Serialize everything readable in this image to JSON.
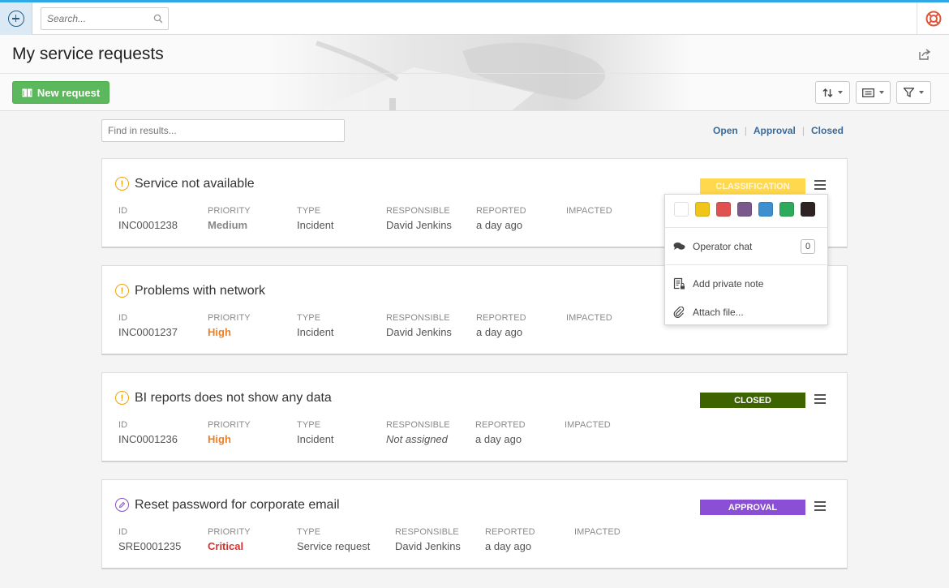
{
  "topbar": {
    "search_placeholder": "Search..."
  },
  "header": {
    "title": "My service requests",
    "new_request_label": "New request"
  },
  "filter": {
    "find_placeholder": "Find in results...",
    "tabs": [
      {
        "label": "Open"
      },
      {
        "label": "Approval"
      },
      {
        "label": "Closed"
      }
    ]
  },
  "field_labels": {
    "id": "ID",
    "priority": "PRIORITY",
    "type": "TYPE",
    "responsible": "RESPONSIBLE",
    "reported": "REPORTED",
    "impacted": "IMPACTED"
  },
  "requests": [
    {
      "title": "Service not available",
      "id": "INC0001238",
      "priority": "Medium",
      "type": "Incident",
      "responsible": "David Jenkins",
      "reported": "a day ago",
      "impacted": "",
      "status": "CLASSIFICATION",
      "status_color": "#ffd84d",
      "icon": "warning-icon"
    },
    {
      "title": "Problems with network",
      "id": "INC0001237",
      "priority": "High",
      "type": "Incident",
      "responsible": "David Jenkins",
      "reported": "a day ago",
      "impacted": "",
      "status": "",
      "icon": "warning-icon"
    },
    {
      "title": "BI reports does not show any data",
      "id": "INC0001236",
      "priority": "High",
      "type": "Incident",
      "responsible": "Not assigned",
      "reported": "a day ago",
      "impacted": "",
      "status": "CLOSED",
      "status_color": "#3e6400",
      "icon": "warning-icon"
    },
    {
      "title": "Reset password for corporate email",
      "id": "SRE0001235",
      "priority": "Critical",
      "type": "Service request",
      "responsible": "David Jenkins",
      "reported": "a day ago",
      "impacted": "",
      "status": "APPROVAL",
      "status_color": "#8a4fd4",
      "icon": "pencil-icon"
    }
  ],
  "dropdown": {
    "colors": [
      "#ffffff",
      "#f0c419",
      "#e05252",
      "#7a5a8c",
      "#3e8fd0",
      "#2eaa5c",
      "#2f2424"
    ],
    "operator_chat_label": "Operator chat",
    "operator_chat_count": "0",
    "add_note_label": "Add private note",
    "attach_file_label": "Attach file..."
  },
  "colors": {
    "accent": "#2ea8e6",
    "new_button": "#5cb85c",
    "link": "#3a6a99",
    "priority_high": "#f07f1e",
    "priority_critical": "#d9302c"
  }
}
